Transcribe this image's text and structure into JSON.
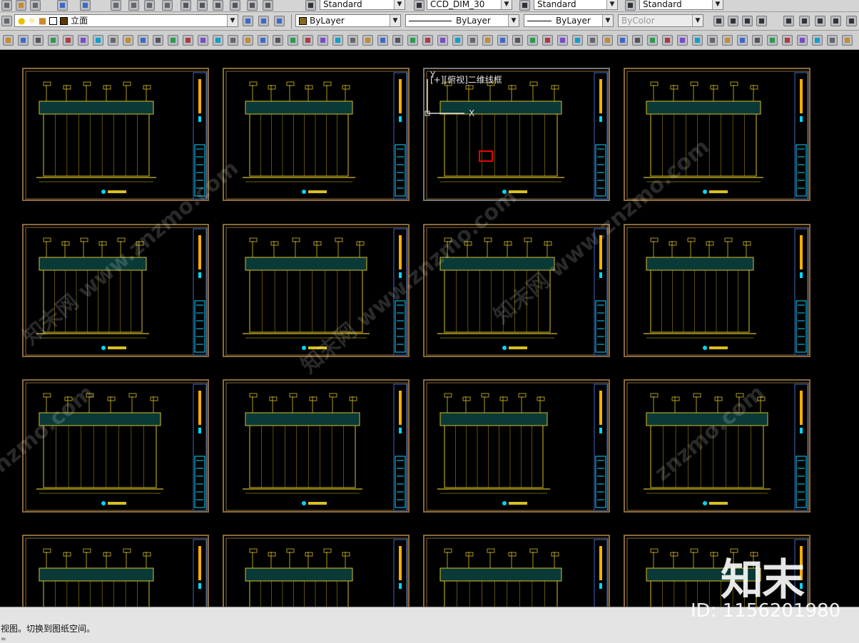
{
  "toolbar_top": {
    "textstyle": "Standard",
    "dimstyle": "CCD_DIM_30",
    "tablestyle": "Standard",
    "mleaderstyle": "Standard"
  },
  "toolbar_layer": {
    "current_layer": "立面",
    "color": "ByLayer",
    "linetype": "ByLayer",
    "lineweight": "ByLayer",
    "plotstyle": "ByColor"
  },
  "viewport": {
    "label": "[+][俯视]二维线框",
    "ucs_y": "Y",
    "ucs_x": "X"
  },
  "command_line": {
    "history": "视图。切换到图纸空间。",
    "prompt": "="
  },
  "watermark": {
    "brand": "知末",
    "id": "ID: 1156201980",
    "site": "znzmo.com",
    "cn": "知末网 www.znzmo.com"
  },
  "colors": {
    "frame": "#8a6a3a",
    "drawing": "#d8c020",
    "accent_cyan": "#00d8ff",
    "accent_orange": "#ffb000",
    "hatch_teal": "#0a3a38"
  }
}
